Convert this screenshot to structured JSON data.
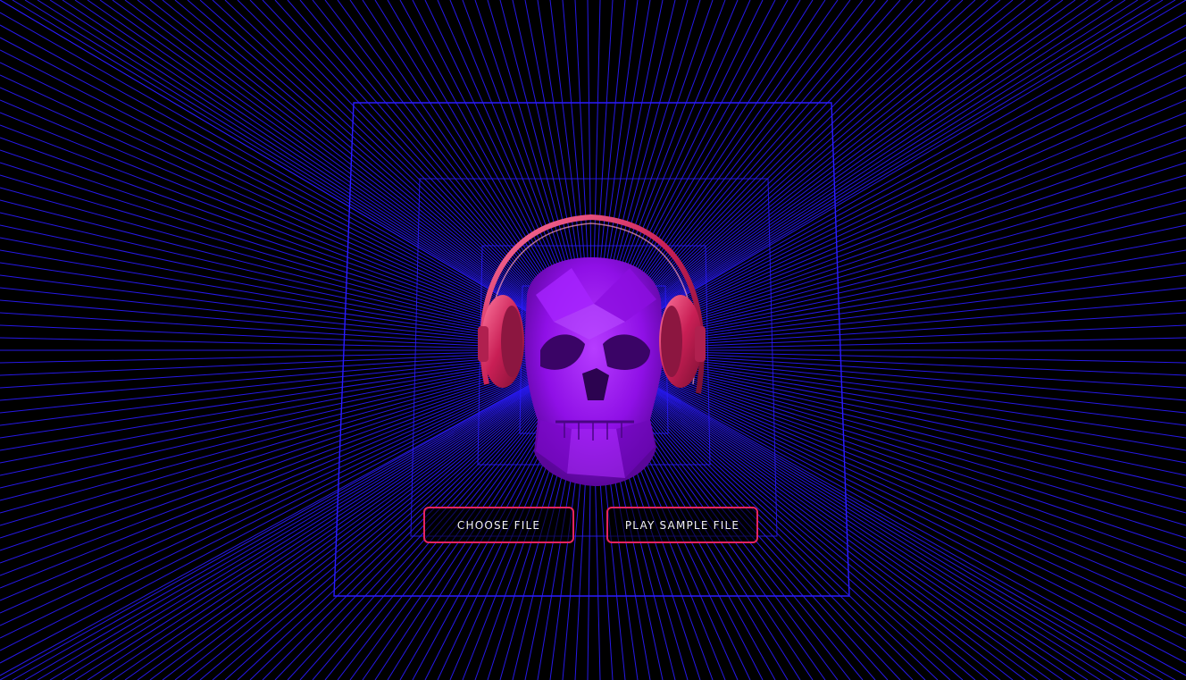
{
  "buttons": {
    "choose_file": "CHOOSE FILE",
    "play_sample": "PLAY SAMPLE FILE"
  },
  "colors": {
    "background": "#000000",
    "grid_line": "#2a1bff",
    "button_border": "#e8245f",
    "button_text": "#f2f2f2",
    "skull": "#9b12f0",
    "headphones": "#d6336b"
  },
  "icons": {
    "centerpiece": "skull-with-headphones-icon"
  }
}
